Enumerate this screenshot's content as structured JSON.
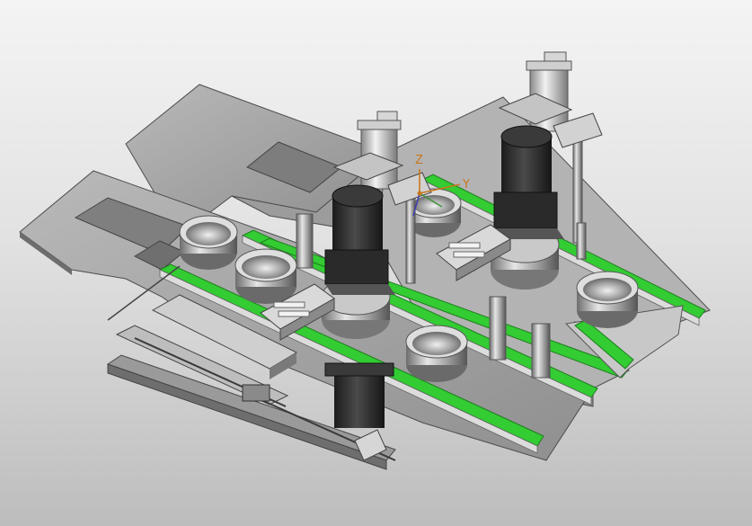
{
  "viewport": {
    "title": "",
    "view": "isometric-3d-assembly",
    "background_gradient": [
      "#f4f4f4",
      "#bdbdbd"
    ]
  },
  "triad": {
    "z_label": "Z",
    "y_label": "Y",
    "label_color": "#c8781e"
  },
  "colors": {
    "plate": "#a6a6a6",
    "plate_edge": "#505050",
    "rail_green": "#33cc33",
    "motor_dark": "#2b2b2b",
    "metal_light": "#d8d8d8",
    "metal_mid": "#8e8e8e"
  },
  "model": {
    "motors": 3,
    "cylinders": 2,
    "cups": 5,
    "green_rails": 4
  }
}
